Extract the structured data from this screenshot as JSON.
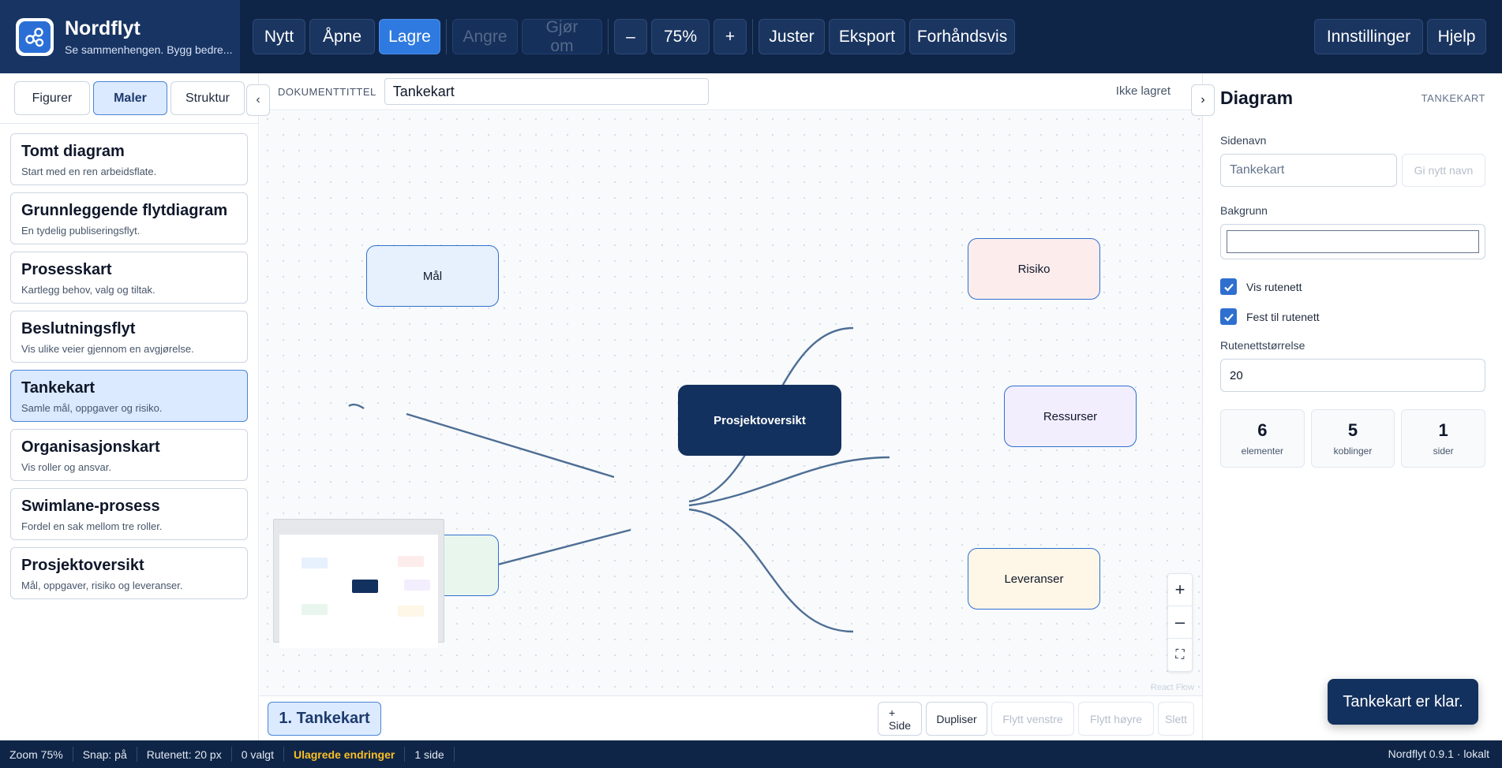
{
  "app": {
    "name": "Nordflyt",
    "tagline": "Se sammenhengen. Bygg bedre..."
  },
  "toolbar": {
    "new": "Nytt",
    "open": "Åpne",
    "save": "Lagre",
    "undo": "Angre",
    "redo": "Gjør om",
    "zoom_out": "–",
    "zoom_level": "75%",
    "zoom_in": "+",
    "align": "Juster",
    "export": "Eksport",
    "preview": "Forhåndsvis",
    "settings": "Innstillinger",
    "help": "Hjelp"
  },
  "sidebar": {
    "tabs": [
      "Figurer",
      "Maler",
      "Struktur"
    ],
    "active_tab": "Maler",
    "collapse_icon": "‹",
    "templates": [
      {
        "title": "Tomt diagram",
        "desc": "Start med en ren arbeidsflate."
      },
      {
        "title": "Grunnleggende flytdiagram",
        "desc": "En tydelig publiseringsflyt."
      },
      {
        "title": "Prosesskart",
        "desc": "Kartlegg behov, valg og tiltak."
      },
      {
        "title": "Beslutningsflyt",
        "desc": "Vis ulike veier gjennom en avgjørelse."
      },
      {
        "title": "Tankekart",
        "desc": "Samle mål, oppgaver og risiko."
      },
      {
        "title": "Organisasjonskart",
        "desc": "Vis roller og ansvar."
      },
      {
        "title": "Swimlane-prosess",
        "desc": "Fordel en sak mellom tre roller."
      },
      {
        "title": "Prosjektoversikt",
        "desc": "Mål, oppgaver, risiko og leveranser."
      }
    ],
    "active_template": "Tankekart"
  },
  "document": {
    "label": "DOKUMENTTITTEL",
    "title": "Tankekart",
    "save_status": "Ikke lagret",
    "panel_toggle_icon": "›"
  },
  "canvas": {
    "nodes": {
      "root": "Prosjektoversikt",
      "goal": "Mål",
      "risk": "Risiko",
      "resources": "Ressurser",
      "deliverables": "Leveranser"
    },
    "node_colors": {
      "root": "#13315e",
      "goal": "#e6f1fd",
      "risk": "#fdecec",
      "resources": "#f3eefe",
      "deliverables": "#fef6e6",
      "tasks": "#e9f6ee",
      "edge": "#4e6e94"
    },
    "attribution": "React Flow",
    "controls": {
      "zoom_in": "+",
      "zoom_out": "–",
      "fit": "⛶"
    }
  },
  "pages": {
    "current": "1. Tankekart",
    "add": "+ Side",
    "duplicate": "Dupliser",
    "move_left": "Flytt venstre",
    "move_right": "Flytt høyre",
    "delete": "Slett"
  },
  "panel": {
    "title": "Diagram",
    "type": "TANKEKART",
    "page_name_label": "Sidenavn",
    "page_name_placeholder": "Tankekart",
    "rename": "Gi nytt navn",
    "background_label": "Bakgrunn",
    "background_color": "#ffffff",
    "show_grid": "Vis rutenett",
    "snap_grid": "Fest til rutenett",
    "grid_size_label": "Rutenettstørrelse",
    "grid_size": "20",
    "stats": [
      {
        "value": "6",
        "label": "elementer"
      },
      {
        "value": "5",
        "label": "koblinger"
      },
      {
        "value": "1",
        "label": "sider"
      }
    ]
  },
  "toast": "Tankekart er klar.",
  "statusbar": {
    "zoom": "Zoom 75%",
    "snap": "Snap: på",
    "grid": "Rutenett: 20 px",
    "selected": "0 valgt",
    "unsaved": "Ulagrede endringer",
    "pages": "1 side",
    "version": "Nordflyt 0.9.1 · lokalt"
  },
  "colors": {
    "header_bg": "#0f2547",
    "brand_bg": "#183463",
    "accent": "#2f7ae0",
    "warning": "#fbbf24"
  }
}
